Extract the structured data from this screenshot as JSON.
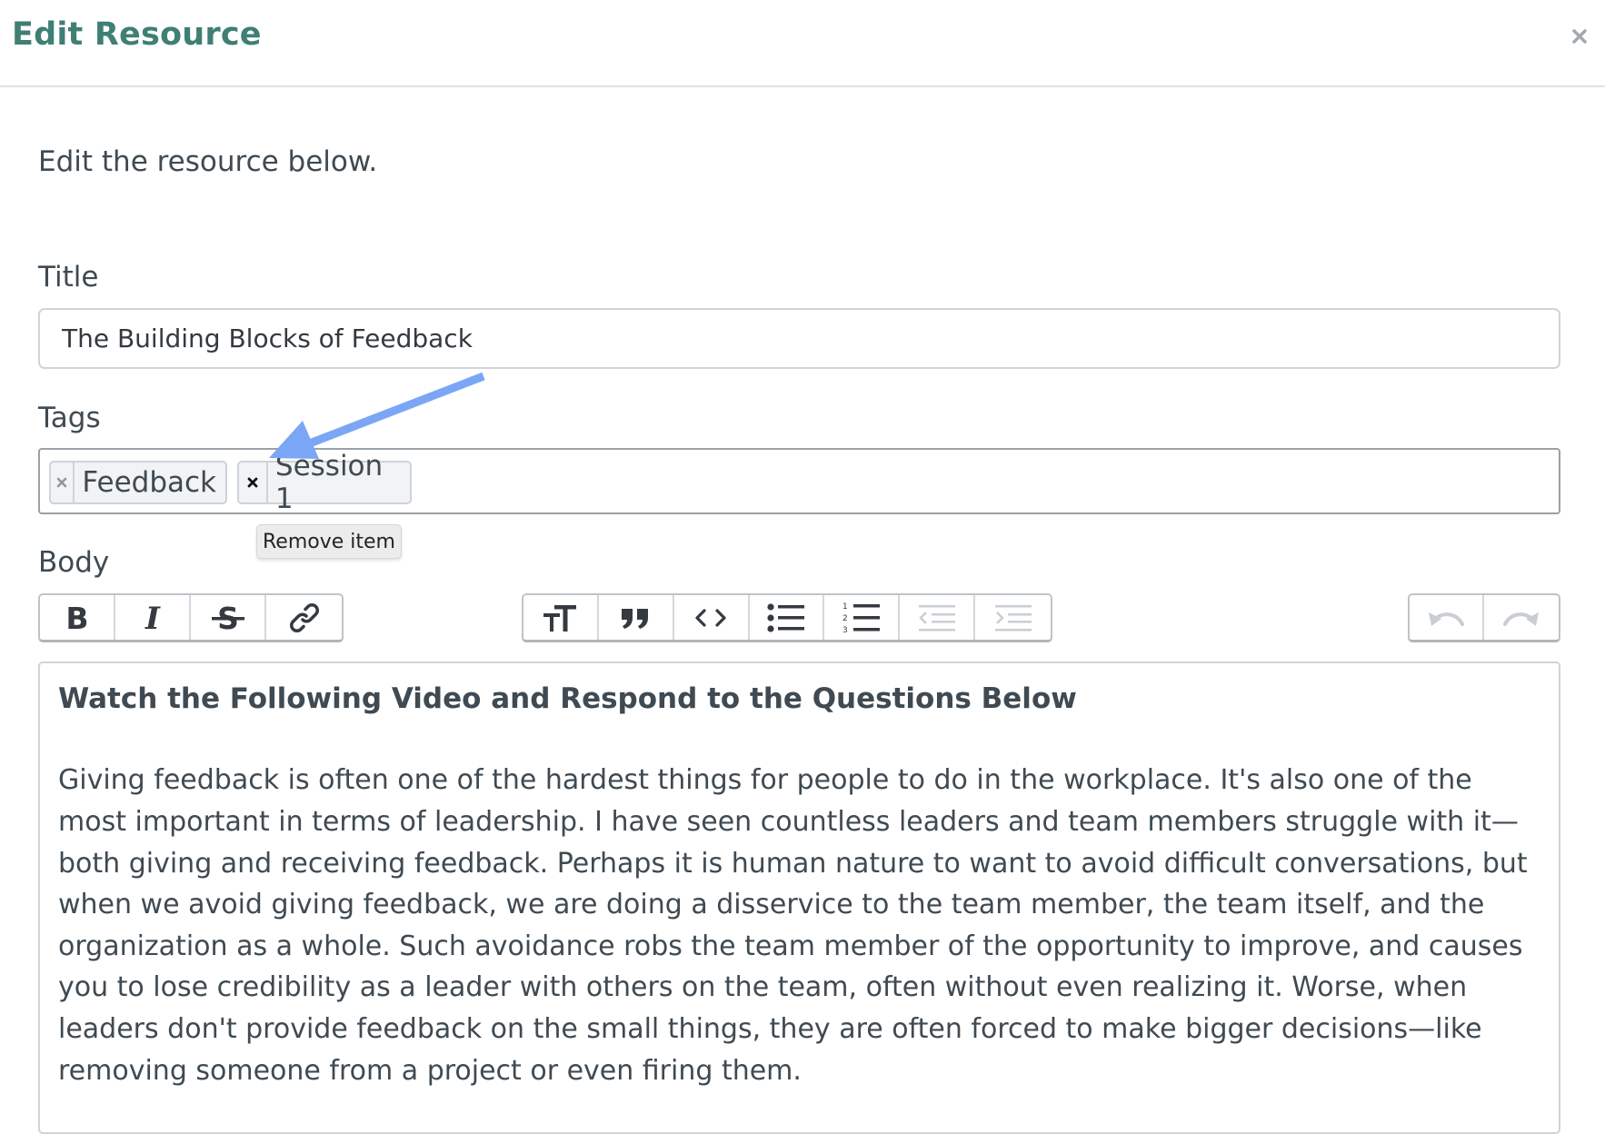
{
  "modal": {
    "title": "Edit Resource",
    "intro": "Edit the resource below."
  },
  "form": {
    "title_label": "Title",
    "title_value": "The Building Blocks of Feedback",
    "tags_label": "Tags",
    "tags": [
      {
        "label": "Feedback"
      },
      {
        "label": "Session 1"
      }
    ],
    "tooltip": "Remove item",
    "body_label": "Body"
  },
  "toolbar": {
    "groups": [
      {
        "buttons": [
          "bold-icon",
          "italic-icon",
          "strikethrough-icon",
          "link-icon"
        ]
      },
      {
        "buttons": [
          "heading-icon",
          "quote-icon",
          "code-icon",
          "bullet-list-icon",
          "numbered-list-icon",
          "outdent-icon",
          "indent-icon"
        ]
      },
      {
        "buttons": [
          "undo-icon",
          "redo-icon"
        ]
      }
    ]
  },
  "editor": {
    "heading": "Watch the Following Video and Respond to the Questions Below",
    "paragraph": "Giving feedback is often one of the hardest things for people to do in the workplace. It's also one of the most important in terms of leadership. I have seen countless leaders and team members struggle with it—both giving and receiving feedback. Perhaps it is human nature to want to avoid difficult conversations, but when we avoid giving feedback, we are doing a disservice to the team member, the team itself, and the organization as a whole. Such avoidance robs the team member of the opportunity to improve, and causes you to lose credibility as a leader with others on the team, often without even realizing it. Worse, when leaders don't provide feedback on the small things, they are often forced to make bigger decisions—like removing someone from a project or even firing them."
  },
  "colors": {
    "title": "#3f7f74",
    "annotation_arrow": "#7aa6f5",
    "text": "#3f4a52"
  }
}
